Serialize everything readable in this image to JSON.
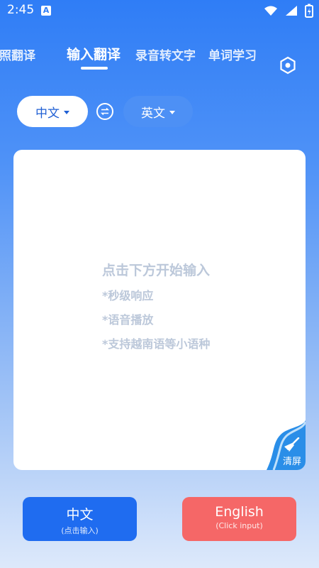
{
  "status_bar": {
    "time": "2:45",
    "app_badge": "A"
  },
  "tabs": [
    {
      "label": "拍照翻译"
    },
    {
      "label": "输入翻译"
    },
    {
      "label": "录音转文字"
    },
    {
      "label": "单词学习"
    }
  ],
  "language_bar": {
    "source": "中文",
    "target": "英文"
  },
  "input_panel": {
    "hint_title": "点击下方开始输入",
    "hint_lines": [
      "*秒级响应",
      "*语音播放",
      "*支持越南语等小语种"
    ],
    "clear_label": "清屏"
  },
  "bottom_buttons": {
    "chinese": {
      "label": "中文",
      "sub": "(点击输入)"
    },
    "english": {
      "label": "English",
      "sub": "(Click input)"
    }
  },
  "colors": {
    "accent": "#2f7df6",
    "chinese_button": "#1f6cf0",
    "english_button": "#f56767",
    "hint_text": "#bcc8da"
  }
}
